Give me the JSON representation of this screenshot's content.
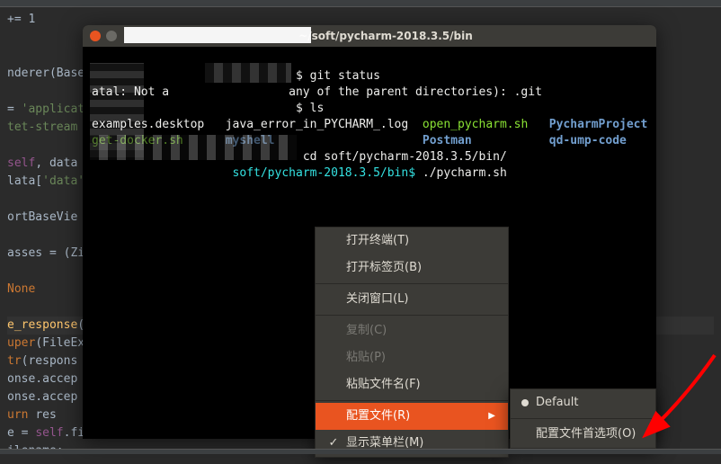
{
  "terminal": {
    "title": "~/soft/pycharm-2018.3.5/bin",
    "lines": {
      "l1_cmd": "$ git status",
      "l2": "  any of the parent directories): .git",
      "l3_cmd": "$ ls",
      "ls_a": "examples.desktop",
      "ls_b": "java_error_in_PYCHARM_.log",
      "ls_c": "open_pycharm.sh",
      "ls_d": "PycharmProject",
      "ls_e": "get-docker.sh",
      "ls_f": "myshell",
      "ls_g": "Postman",
      "ls_h": "qd-ump-code",
      "l6_cmd": "cd soft/pycharm-2018.3.5/bin/",
      "l7_prompt": "soft/pycharm-2018.3.5/bin$ ",
      "l7_cmd": "./pycharm.sh"
    },
    "fatal_fragment": "atal: Not a "
  },
  "ide_code": {
    "l1": "+= 1",
    "l2": "nderer(Base",
    "l3a": "= ",
    "l3b": "'applicat",
    "l3c": "a",
    "l4": "tet-stream",
    "l5a": "self",
    "l5b": ", data",
    "l6a": "lata[",
    "l6b": "'data'",
    "l8": "ortBaseVie",
    "l9a": "asses = (Zi",
    "l10": "None",
    "l11a": "e_response",
    "l11b": "(",
    "l12a": "uper",
    "l12b": "(FileEx",
    "l13a": "tr",
    "l13b": "(respons",
    "l14": "onse.accep",
    "l15": "onse.accep",
    "l16a": "urn ",
    "l16b": "res",
    "l17a": "e = ",
    "l17b": "self",
    "l17c": ".fi",
    "l18": "ilename:"
  },
  "context_menu": {
    "open_terminal": "打开终端(T)",
    "open_tab": "打开标签页(B)",
    "close_window": "关闭窗口(L)",
    "copy": "复制(C)",
    "paste": "粘贴(P)",
    "paste_filename": "粘贴文件名(F)",
    "profile": "配置文件(R)",
    "show_menubar": "显示菜单栏(M)"
  },
  "sub_menu": {
    "default": "Default",
    "prefs": "配置文件首选项(O)"
  }
}
